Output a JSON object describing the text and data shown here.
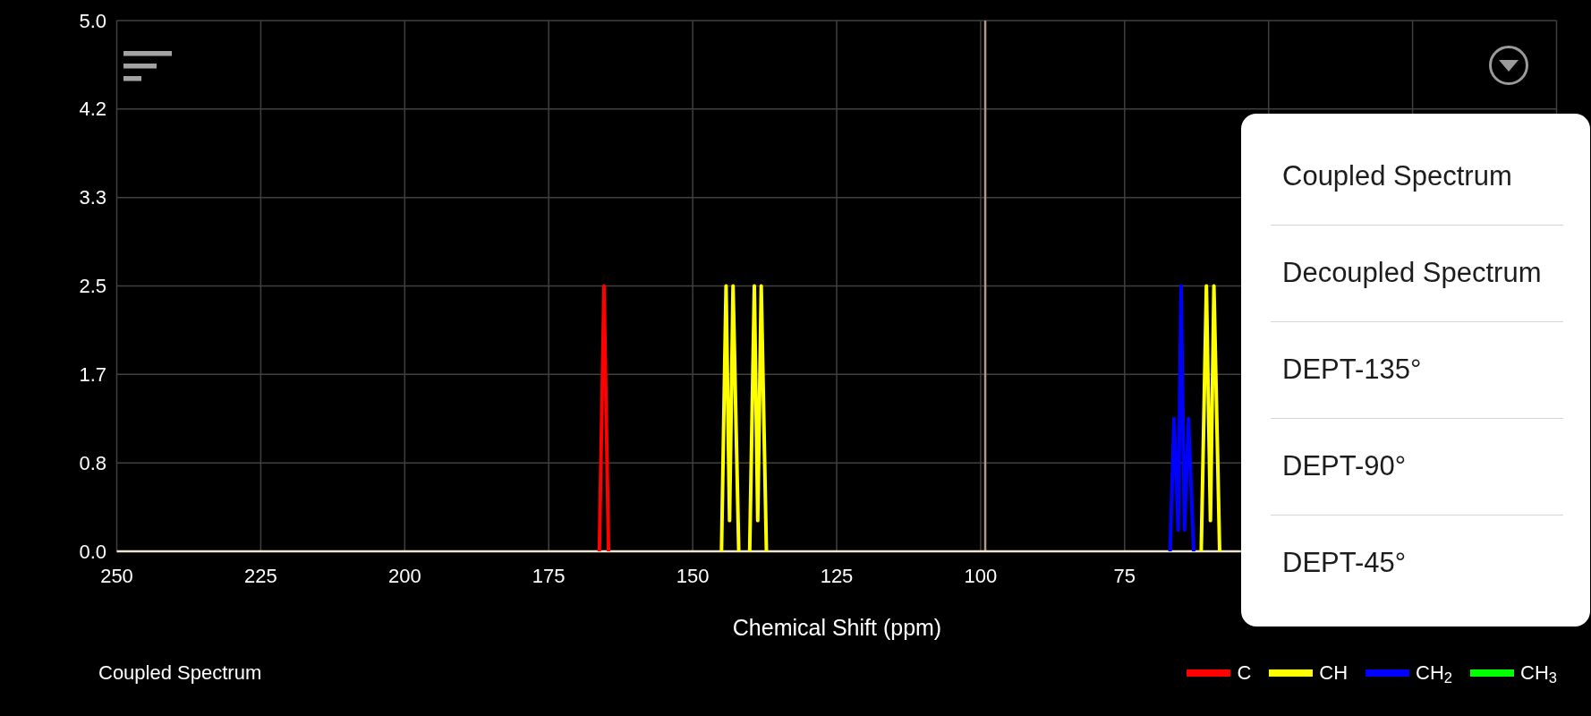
{
  "spectrum_chart": {
    "chart_data": {
      "type": "line",
      "xlabel": "Chemical Shift (ppm)",
      "xlim": [
        250,
        0
      ],
      "ylim": [
        0,
        5
      ],
      "grid": true,
      "xticks": [
        250,
        225,
        200,
        175,
        150,
        125,
        100,
        75
      ],
      "yticks": [
        {
          "value": 0,
          "label": "0.0"
        },
        {
          "value": 0.833,
          "label": "0.8"
        },
        {
          "value": 1.667,
          "label": "1.7"
        },
        {
          "value": 2.5,
          "label": "2.5"
        },
        {
          "value": 3.333,
          "label": "3.3"
        },
        {
          "value": 4.167,
          "label": "4.2"
        },
        {
          "value": 5,
          "label": "5.0"
        }
      ],
      "x": [
        166.2,
        165.4,
        164.6,
        145.0,
        144.2,
        143.6,
        143.0,
        142.0,
        140.1,
        139.3,
        138.7,
        138.1,
        137.2,
        67.1,
        66.4,
        65.7,
        65.2,
        64.6,
        63.9,
        63.0,
        61.7,
        60.8,
        60.1,
        59.5,
        58.5
      ],
      "series": [
        {
          "name": "C",
          "color": "#ff0000",
          "values": [
            0,
            2.5,
            0,
            null,
            null,
            null,
            null,
            null,
            null,
            null,
            null,
            null,
            null,
            null,
            null,
            null,
            null,
            null,
            null,
            null,
            null,
            null,
            null,
            null,
            null
          ]
        },
        {
          "name": "CH",
          "color": "#ffff00",
          "values": [
            null,
            null,
            null,
            0,
            2.5,
            0.29,
            2.5,
            0,
            0,
            2.5,
            0.29,
            2.5,
            0,
            null,
            null,
            null,
            null,
            null,
            null,
            null,
            0,
            2.5,
            0.29,
            2.5,
            0
          ]
        },
        {
          "name": "CH$_{2}$",
          "color": "#0000ff",
          "values": [
            null,
            null,
            null,
            null,
            null,
            null,
            null,
            null,
            null,
            null,
            null,
            null,
            null,
            0,
            1.25,
            0.2,
            2.5,
            0.2,
            1.25,
            0,
            null,
            null,
            null,
            null,
            null
          ]
        },
        {
          "name": "CH$_{3}$",
          "color": "#00ff00",
          "values": [
            null,
            null,
            null,
            null,
            null,
            null,
            null,
            null,
            null,
            null,
            null,
            null,
            null,
            null,
            null,
            null,
            null,
            null,
            null,
            null,
            null,
            null,
            null,
            null,
            null
          ]
        }
      ],
      "ref_lines": [
        {
          "axis": "x",
          "value": 99.2,
          "color": "#b0968a"
        }
      ]
    }
  },
  "current_spectrum": "Coupled Spectrum",
  "spectrum_menu": {
    "items": [
      "Coupled Spectrum",
      "Decoupled Spectrum",
      "DEPT-135°",
      "DEPT-90°",
      "DEPT-45°"
    ]
  }
}
